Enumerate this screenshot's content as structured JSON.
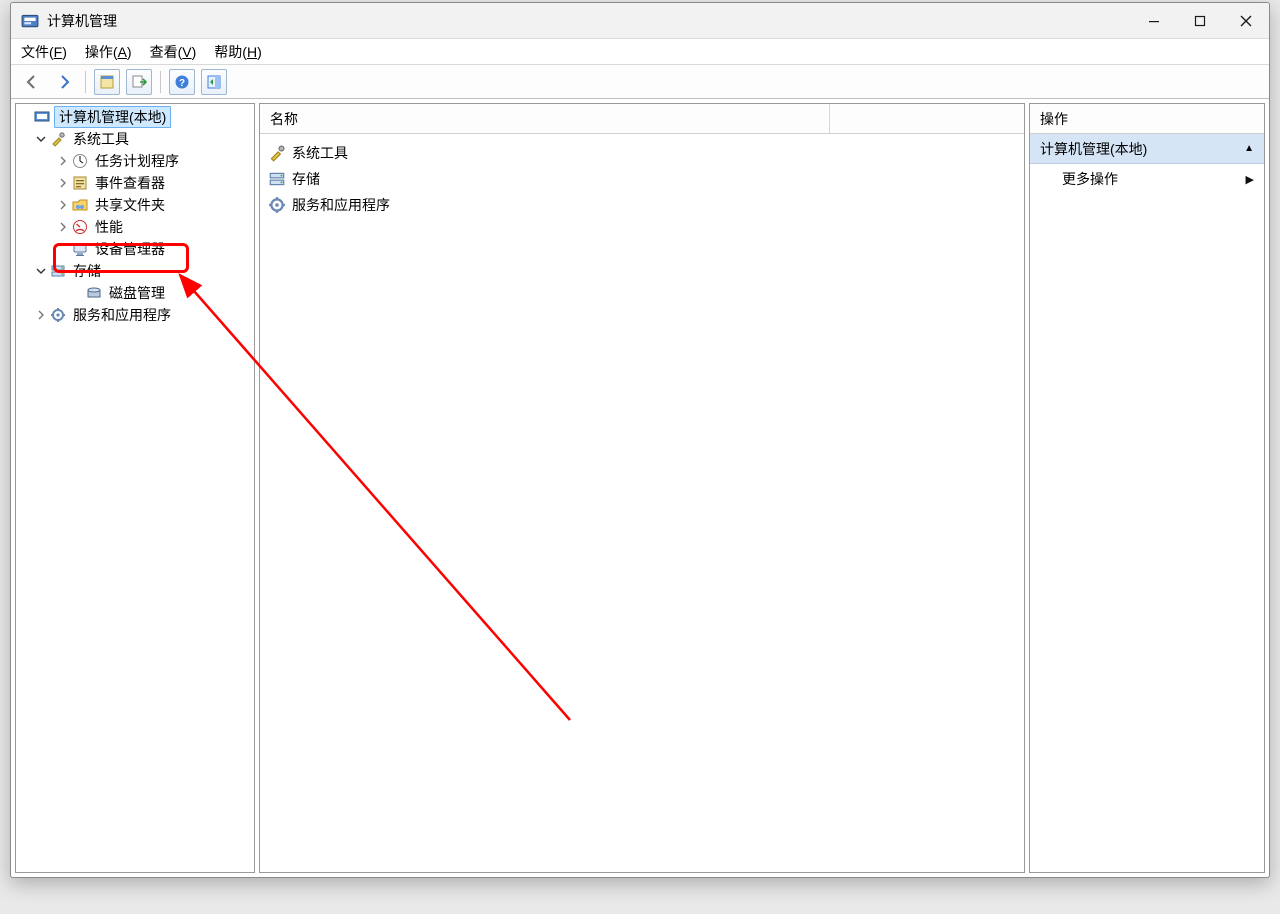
{
  "window": {
    "title": "计算机管理"
  },
  "menubar": {
    "items": [
      {
        "label_pre": "文件(",
        "accel": "F",
        "label_post": ")"
      },
      {
        "label_pre": "操作(",
        "accel": "A",
        "label_post": ")"
      },
      {
        "label_pre": "查看(",
        "accel": "V",
        "label_post": ")"
      },
      {
        "label_pre": "帮助(",
        "accel": "H",
        "label_post": ")"
      }
    ]
  },
  "toolbar": {
    "back_icon": "back",
    "forward_icon": "forward",
    "props_icon": "properties",
    "export_icon": "export",
    "help_icon": "help",
    "show_icon": "show-hide"
  },
  "tree": {
    "root": {
      "label": "计算机管理(本地)"
    },
    "system_tools": {
      "label": "系统工具"
    },
    "task_scheduler": {
      "label": "任务计划程序"
    },
    "event_viewer": {
      "label": "事件查看器"
    },
    "shared_folders": {
      "label": "共享文件夹"
    },
    "performance": {
      "label": "性能"
    },
    "device_manager": {
      "label": "设备管理器"
    },
    "storage": {
      "label": "存储"
    },
    "disk_mgmt": {
      "label": "磁盘管理"
    },
    "services_apps": {
      "label": "服务和应用程序"
    }
  },
  "list": {
    "header": {
      "name": "名称"
    },
    "rows": [
      {
        "label": "系统工具",
        "icon": "tools"
      },
      {
        "label": "存储",
        "icon": "storage"
      },
      {
        "label": "服务和应用程序",
        "icon": "services"
      }
    ]
  },
  "actions": {
    "header": "操作",
    "section": "计算机管理(本地)",
    "more": "更多操作"
  }
}
